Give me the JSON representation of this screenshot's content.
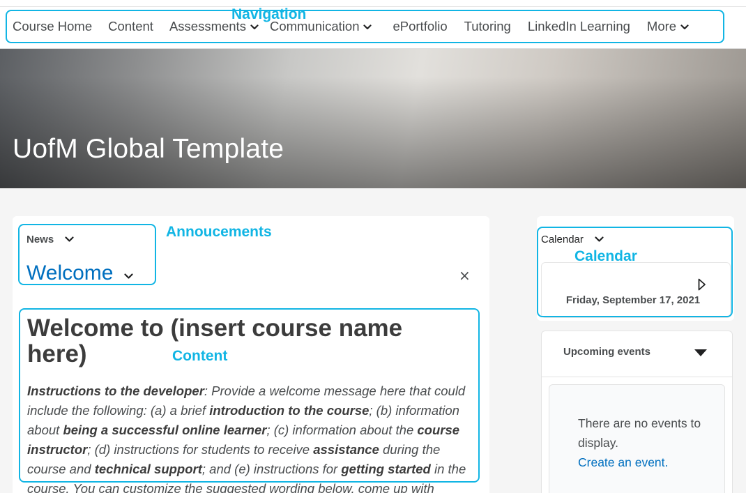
{
  "nav": {
    "items": [
      {
        "label": "Course Home",
        "dropdown": false
      },
      {
        "label": "Content",
        "dropdown": false
      },
      {
        "label": "Assessments",
        "dropdown": true
      },
      {
        "label": "Communication",
        "dropdown": true
      },
      {
        "label": "ePortfolio",
        "dropdown": false
      },
      {
        "label": "Tutoring",
        "dropdown": false
      },
      {
        "label": "LinkedIn Learning",
        "dropdown": false
      },
      {
        "label": "More",
        "dropdown": true
      }
    ]
  },
  "hero": {
    "title": "UofM Global Template"
  },
  "news": {
    "header": "News",
    "item_title": "Welcome",
    "close_glyph": "×",
    "content_title": "Welcome to (insert course name here)",
    "content_body": [
      {
        "text": "Instructions to the developer",
        "bold": true
      },
      {
        "text": ": Provide a welcome message here that could include the following: (a) a brief ",
        "bold": false
      },
      {
        "text": "introduction to the course",
        "bold": true
      },
      {
        "text": "; (b) information about ",
        "bold": false
      },
      {
        "text": "being a successful online learner",
        "bold": true
      },
      {
        "text": "; (c) information about the ",
        "bold": false
      },
      {
        "text": "course instructor",
        "bold": true
      },
      {
        "text": "; (d) instructions for students to receive ",
        "bold": false
      },
      {
        "text": "assistance",
        "bold": true
      },
      {
        "text": " during the course and ",
        "bold": false
      },
      {
        "text": "technical support",
        "bold": true
      },
      {
        "text": "; and (e) instructions for ",
        "bold": false
      },
      {
        "text": "getting started",
        "bold": true
      },
      {
        "text": " in the course. You can customize the suggested wording below, come up with",
        "bold": false
      }
    ]
  },
  "calendar": {
    "header": "Calendar",
    "date": "Friday, September 17, 2021"
  },
  "events": {
    "title": "Upcoming events",
    "empty_message": "There are no events to display.",
    "create_link": "Create an event."
  },
  "annotations": {
    "navigation": "Navigation",
    "announcements": "Annoucements",
    "calendar": "Calendar",
    "content": "Content"
  },
  "colors": {
    "accent": "#11b5e4",
    "link": "#006fbf",
    "text": "#494c4e"
  }
}
